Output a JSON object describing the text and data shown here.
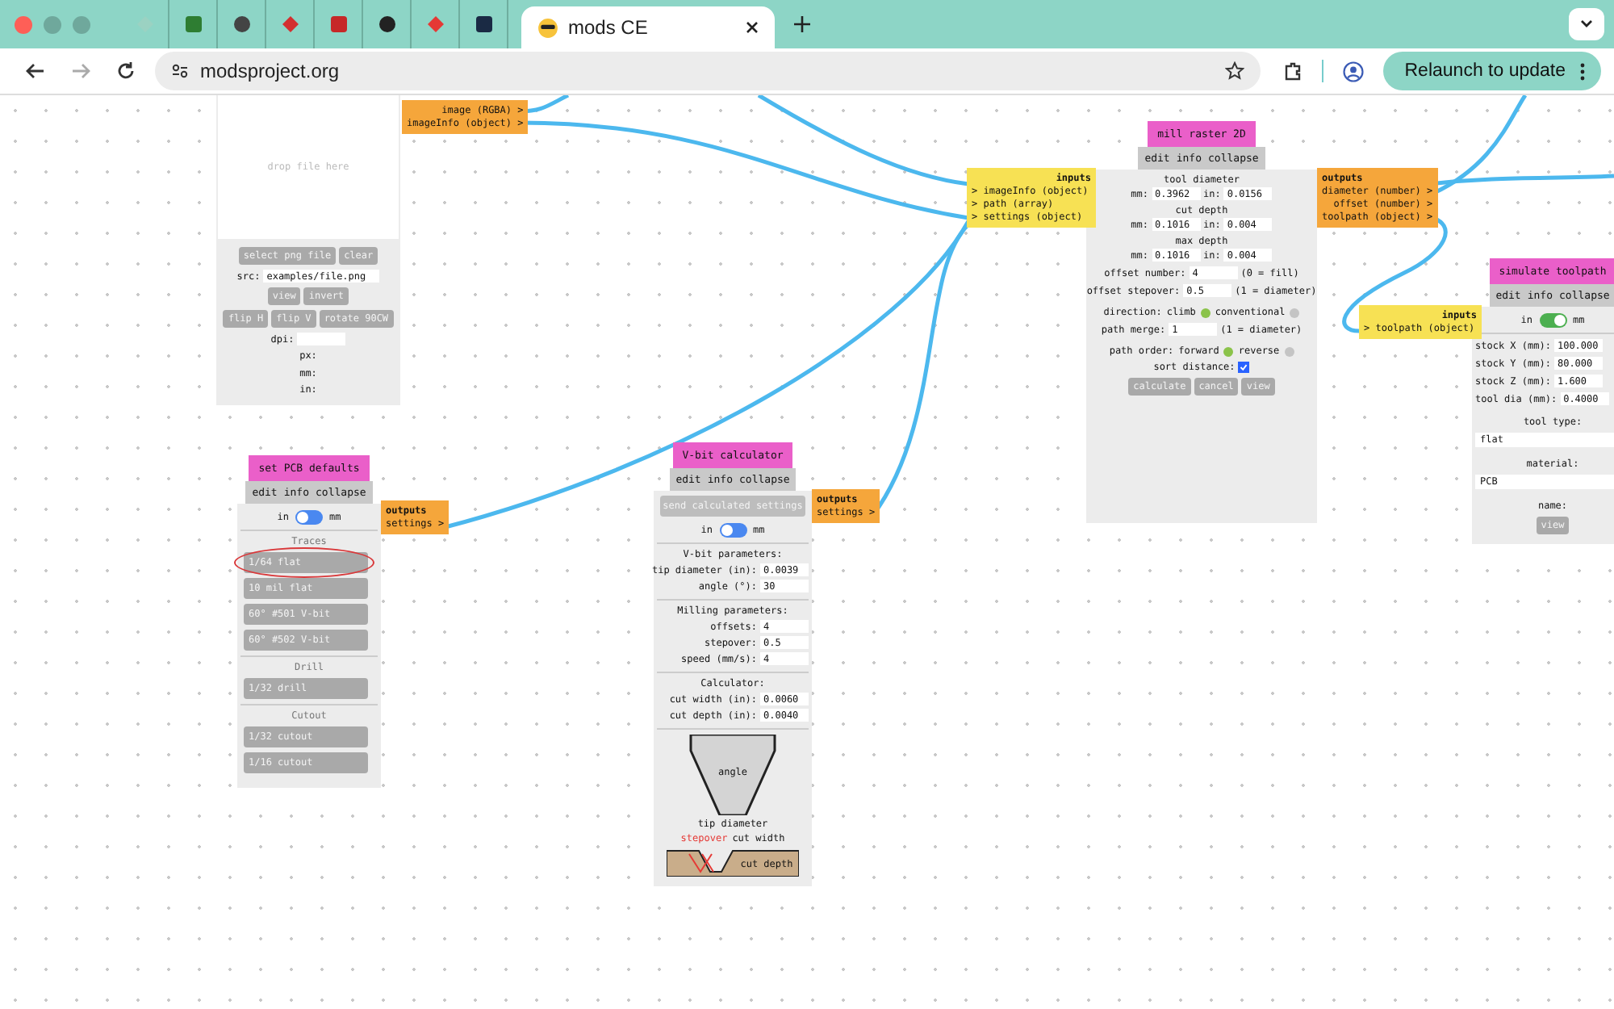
{
  "browser": {
    "tabs": [
      {
        "kind": "favicon",
        "selected": false
      },
      {
        "kind": "favicon",
        "selected": false
      },
      {
        "kind": "favicon",
        "selected": false
      },
      {
        "kind": "favicon",
        "selected": false
      },
      {
        "kind": "favicon",
        "selected": false
      },
      {
        "kind": "favicon",
        "selected": false
      },
      {
        "kind": "favicon",
        "selected": false
      },
      {
        "kind": "favicon",
        "selected": false
      },
      {
        "kind": "page",
        "title": "mods CE",
        "selected": true
      }
    ],
    "url": "modsproject.org",
    "relaunch_button": "Relaunch to update"
  },
  "modules": [
    {
      "kind": "image_reader",
      "drop_hint": "drop file here",
      "button_rows": [
        [
          "select png file",
          "clear"
        ]
      ],
      "src_label": "src:",
      "src_value": "examples/file.png",
      "more_button_rows": [
        [
          "view",
          "invert"
        ],
        [
          "flip H",
          "flip V",
          "rotate 90CW"
        ]
      ],
      "dpi_label": "dpi:",
      "info_lines": [
        "px:",
        "mm:",
        "in:"
      ],
      "outputs": [
        "image (RGBA) >",
        "imageInfo (object) >"
      ]
    },
    {
      "kind": "pcb_defaults",
      "title": "set PCB defaults",
      "menu": [
        "edit",
        "info",
        "collapse"
      ],
      "units": {
        "left": "in",
        "right": "mm",
        "on": false
      },
      "sections": [
        {
          "heading": "Traces",
          "buttons": [
            {
              "label": "1/64 flat",
              "circled": true
            },
            {
              "label": "10 mil flat",
              "circled": false
            },
            {
              "label": "60° #501 V-bit",
              "circled": false
            },
            {
              "label": "60° #502 V-bit",
              "circled": false
            }
          ]
        },
        {
          "heading": "Drill",
          "buttons": [
            {
              "label": "1/32 drill",
              "circled": false
            }
          ]
        },
        {
          "heading": "Cutout",
          "buttons": [
            {
              "label": "1/32 cutout",
              "circled": false
            },
            {
              "label": "1/16 cutout",
              "circled": false
            }
          ]
        }
      ],
      "outputs_heading": "outputs",
      "outputs": [
        "settings >"
      ]
    },
    {
      "kind": "vbit",
      "title": "V-bit calculator",
      "menu": [
        "edit",
        "info",
        "collapse"
      ],
      "send_button": "send calculated settings",
      "units": {
        "left": "in",
        "right": "mm",
        "on": false
      },
      "groups": [
        {
          "heading": "V-bit parameters:",
          "fields": [
            {
              "label": "tip diameter (in):",
              "value": "0.0039"
            },
            {
              "label": "angle (°):",
              "value": "30"
            }
          ]
        },
        {
          "heading": "Milling parameters:",
          "fields": [
            {
              "label": "offsets:",
              "value": "4"
            },
            {
              "label": "stepover:",
              "value": "0.5"
            },
            {
              "label": "speed (mm/s):",
              "value": "4"
            }
          ]
        },
        {
          "heading": "Calculator:",
          "fields": [
            {
              "label": "cut width (in):",
              "value": "0.0060"
            },
            {
              "label": "cut depth (in):",
              "value": "0.0040"
            }
          ]
        }
      ],
      "diagram": {
        "angle": "angle",
        "tip": "tip diameter",
        "stepover": "stepover",
        "cut_width": "cut width",
        "cut_depth": "cut depth"
      },
      "outputs_heading": "outputs",
      "outputs": [
        "settings >"
      ]
    },
    {
      "kind": "mill_raster",
      "title": "mill raster 2D",
      "menu": [
        "edit",
        "info",
        "collapse"
      ],
      "inputs_heading": "inputs",
      "inputs": [
        "> imageInfo (object)",
        "> path (array)",
        "> settings (object)"
      ],
      "params": [
        {
          "heading": "tool diameter",
          "fields": [
            {
              "label": "mm:",
              "value": "0.3962"
            },
            {
              "label": "in:",
              "value": "0.0156"
            }
          ]
        },
        {
          "heading": "cut depth",
          "fields": [
            {
              "label": "mm:",
              "value": "0.1016"
            },
            {
              "label": "in:",
              "value": "0.004"
            }
          ]
        },
        {
          "heading": "max depth",
          "fields": [
            {
              "label": "mm:",
              "value": "0.1016"
            },
            {
              "label": "in:",
              "value": "0.004"
            }
          ]
        }
      ],
      "rows": [
        {
          "label": "offset number:",
          "value": "4",
          "note": "(0 = fill)"
        },
        {
          "label": "offset stepover:",
          "value": "0.5",
          "note": "(1 = diameter)"
        }
      ],
      "direction": {
        "label": "direction:",
        "options": [
          {
            "label": "climb",
            "selected": true
          },
          {
            "label": "conventional",
            "selected": false
          }
        ]
      },
      "path_merge": {
        "label": "path merge:",
        "value": "1",
        "note": "(1 = diameter)"
      },
      "path_order": {
        "label": "path order:",
        "options": [
          {
            "label": "forward",
            "selected": true
          },
          {
            "label": "reverse",
            "selected": false
          }
        ]
      },
      "sort_distance": {
        "label": "sort distance:",
        "checked": true
      },
      "buttons": [
        "calculate",
        "cancel",
        "view"
      ],
      "outputs_heading": "outputs",
      "outputs": [
        "diameter (number) >",
        "offset (number) >",
        "toolpath (object) >"
      ]
    },
    {
      "kind": "simulate",
      "title": "simulate toolpath",
      "menu": [
        "edit",
        "info",
        "collapse"
      ],
      "inputs_heading": "inputs",
      "inputs": [
        "> toolpath (object)"
      ],
      "units": {
        "left": "in",
        "right": "mm",
        "on": true
      },
      "fields": [
        {
          "label": "stock X (mm):",
          "value": "100.000"
        },
        {
          "label": "stock Y (mm):",
          "value": "80.000"
        },
        {
          "label": "stock Z (mm):",
          "value": "1.600"
        },
        {
          "label": "tool dia (mm):",
          "value": "0.4000"
        }
      ],
      "selects": [
        {
          "label": "tool type:",
          "value": "flat"
        },
        {
          "label": "material:",
          "value": "PCB"
        }
      ],
      "name_label": "name:",
      "buttons": [
        "view"
      ]
    }
  ]
}
